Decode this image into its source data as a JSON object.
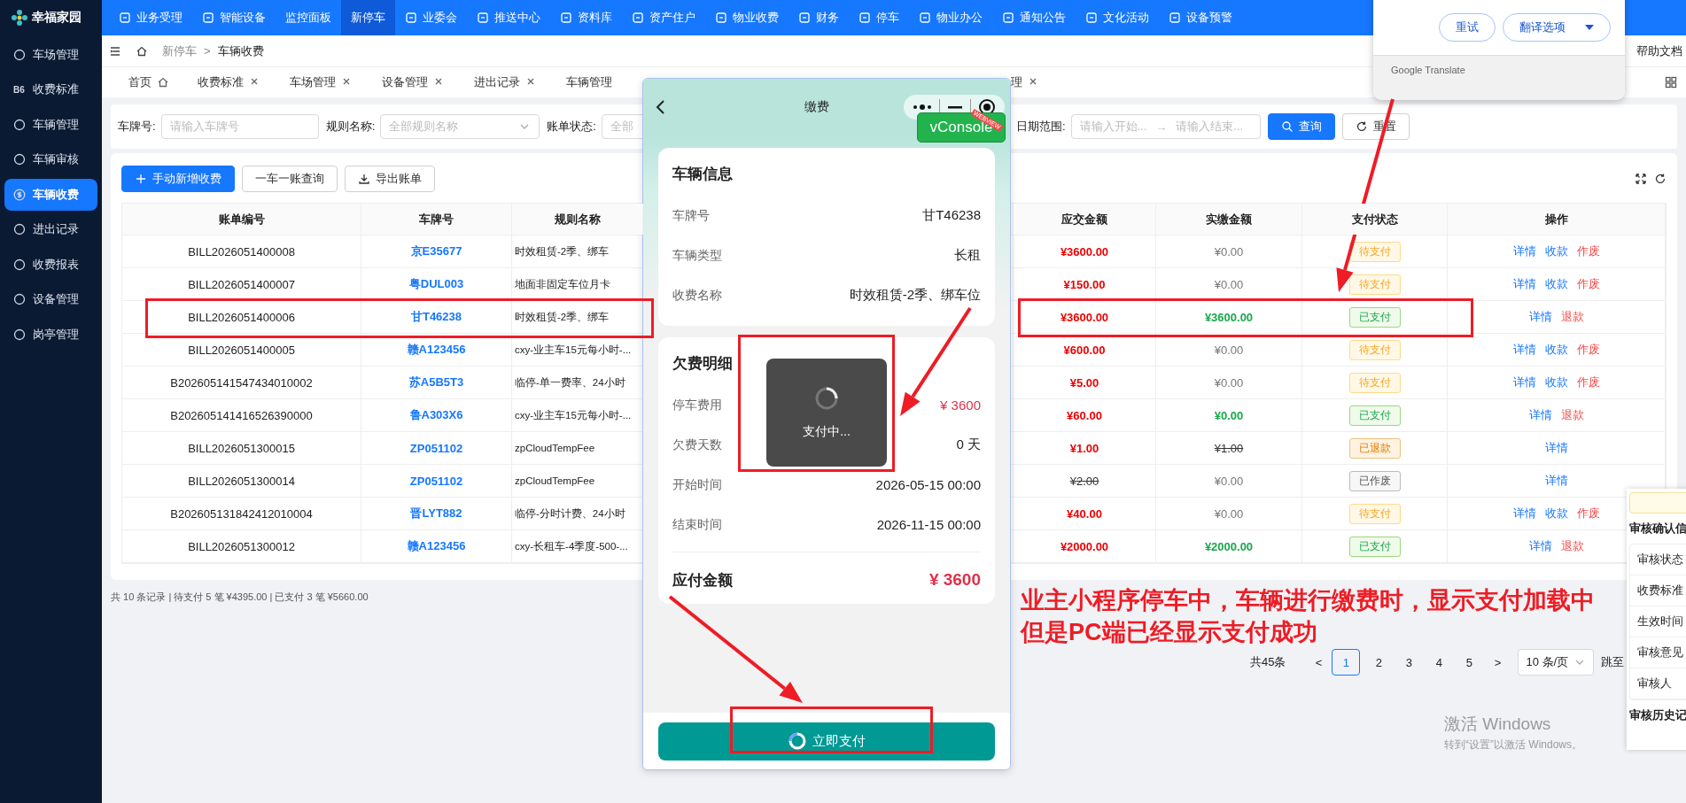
{
  "app": {
    "logo": "幸福家园"
  },
  "top_nav": [
    {
      "label": "业务受理",
      "selected": false,
      "has_icon": true
    },
    {
      "label": "智能设备",
      "selected": false,
      "has_icon": true
    },
    {
      "label": "监控面板",
      "selected": false,
      "has_icon": false
    },
    {
      "label": "新停车",
      "selected": true,
      "has_icon": false
    },
    {
      "label": "业委会",
      "selected": false,
      "has_icon": true
    },
    {
      "label": "推送中心",
      "selected": false,
      "has_icon": true
    },
    {
      "label": "资料库",
      "selected": false,
      "has_icon": true
    },
    {
      "label": "资产住户",
      "selected": false,
      "has_icon": true
    },
    {
      "label": "物业收费",
      "selected": false,
      "has_icon": true
    },
    {
      "label": "财务",
      "selected": false,
      "has_icon": true
    },
    {
      "label": "停车",
      "selected": false,
      "has_icon": true
    },
    {
      "label": "物业办公",
      "selected": false,
      "has_icon": true
    },
    {
      "label": "通知公告",
      "selected": false,
      "has_icon": true
    },
    {
      "label": "文化活动",
      "selected": false,
      "has_icon": true
    },
    {
      "label": "设备预警",
      "selected": false,
      "has_icon": true
    }
  ],
  "sidebar": {
    "items": [
      {
        "label": "车场管理",
        "selected": false
      },
      {
        "label": "收费标准",
        "selected": false,
        "badge": "B6"
      },
      {
        "label": "车辆管理",
        "selected": false
      },
      {
        "label": "车辆审核",
        "selected": false
      },
      {
        "label": "车辆收费",
        "selected": true
      },
      {
        "label": "进出记录",
        "selected": false
      },
      {
        "label": "收费报表",
        "selected": false
      },
      {
        "label": "设备管理",
        "selected": false
      },
      {
        "label": "岗亭管理",
        "selected": false
      }
    ]
  },
  "breadcrumb": {
    "items": [
      "新停车",
      "车辆收费"
    ],
    "separator": ">"
  },
  "help_link": "帮助文档",
  "tab_bar": {
    "tabs": [
      {
        "label": "首页",
        "selected": false,
        "closable": false,
        "home": true
      },
      {
        "label": "收费标准",
        "selected": false,
        "closable": true
      },
      {
        "label": "车场管理",
        "selected": false,
        "closable": true
      },
      {
        "label": "设备管理",
        "selected": false,
        "closable": true
      },
      {
        "label": "进出记录",
        "selected": false,
        "closable": true
      },
      {
        "label": "车辆管理",
        "selected": false,
        "closable": false
      }
    ],
    "more_tabs": [
      {
        "label": "理",
        "selected": false,
        "closable": true
      }
    ]
  },
  "filter_bar": {
    "fields": [
      {
        "label": "车牌号:",
        "placeholder": "请输入车牌号",
        "kind": "text"
      },
      {
        "label": "规则名称:",
        "placeholder": "全部规则名称",
        "kind": "select"
      },
      {
        "label": "账单状态:",
        "placeholder": "全部",
        "kind": "clipped"
      }
    ],
    "date_range": {
      "label": "日期范围:",
      "start_placeholder": "请输入开始...",
      "separator": "→",
      "end_placeholder": "请输入结束..."
    },
    "buttons": [
      {
        "label": "查询",
        "kind": "primary"
      },
      {
        "label": "重置",
        "kind": "default"
      }
    ]
  },
  "toolbar": {
    "buttons": [
      {
        "label": "手动新增收费",
        "kind": "primary"
      },
      {
        "label": "一车一账查询",
        "kind": "default"
      },
      {
        "label": "导出账单",
        "kind": "export"
      }
    ]
  },
  "table": {
    "columns": [
      "账单编号",
      "车牌号",
      "规则名称",
      "应交金额",
      "实缴金额",
      "支付状态",
      "操作"
    ],
    "rows": [
      {
        "bill": "BILL2026051400008",
        "plate": "京E35677",
        "rule": "时效租赁-2季、绑车",
        "due": {
          "text": "¥3600.00",
          "struck": false
        },
        "paid": {
          "text": "¥0.00",
          "struck": false,
          "kind": "muted"
        },
        "status": {
          "label": "待支付",
          "kind": "pending"
        },
        "actions": [
          {
            "label": "详情",
            "kind": "link"
          },
          {
            "label": "收款",
            "kind": "link"
          },
          {
            "label": "作废",
            "kind": "danger"
          }
        ]
      },
      {
        "bill": "BILL2026051400007",
        "plate": "粤DUL003",
        "rule": "地面非固定车位月卡",
        "due": {
          "text": "¥150.00",
          "struck": false
        },
        "paid": {
          "text": "¥0.00",
          "struck": false,
          "kind": "muted"
        },
        "status": {
          "label": "待支付",
          "kind": "pending"
        },
        "actions": [
          {
            "label": "详情",
            "kind": "link"
          },
          {
            "label": "收款",
            "kind": "link"
          },
          {
            "label": "作废",
            "kind": "danger"
          }
        ]
      },
      {
        "bill": "BILL2026051400006",
        "plate": "甘T46238",
        "rule": "时效租赁-2季、绑车",
        "due": {
          "text": "¥3600.00",
          "struck": false
        },
        "paid": {
          "text": "¥3600.00",
          "struck": false,
          "kind": "success"
        },
        "status": {
          "label": "已支付",
          "kind": "paid"
        },
        "actions": [
          {
            "label": "详情",
            "kind": "link"
          },
          {
            "label": "退款",
            "kind": "danger"
          }
        ]
      },
      {
        "bill": "BILL2026051400005",
        "plate": "赣A123456",
        "rule": "cxy-业主车15元每小时-...",
        "due": {
          "text": "¥600.00",
          "struck": false
        },
        "paid": {
          "text": "¥0.00",
          "struck": false,
          "kind": "muted"
        },
        "status": {
          "label": "待支付",
          "kind": "pending"
        },
        "actions": [
          {
            "label": "详情",
            "kind": "link"
          },
          {
            "label": "收款",
            "kind": "link"
          },
          {
            "label": "作废",
            "kind": "danger"
          }
        ]
      },
      {
        "bill": "B202605141547434010002",
        "plate": "苏A5B5T3",
        "rule": "临停-单一费率、24小时",
        "due": {
          "text": "¥5.00",
          "struck": false
        },
        "paid": {
          "text": "¥0.00",
          "struck": false,
          "kind": "muted"
        },
        "status": {
          "label": "待支付",
          "kind": "pending"
        },
        "actions": [
          {
            "label": "详情",
            "kind": "link"
          },
          {
            "label": "收款",
            "kind": "link"
          },
          {
            "label": "作废",
            "kind": "danger"
          }
        ]
      },
      {
        "bill": "B202605141416526390000",
        "plate": "鲁A303X6",
        "rule": "cxy-业主车15元每小时-...",
        "due": {
          "text": "¥60.00",
          "struck": false
        },
        "paid": {
          "text": "¥0.00",
          "struck": false,
          "kind": "success"
        },
        "status": {
          "label": "已支付",
          "kind": "paid"
        },
        "actions": [
          {
            "label": "详情",
            "kind": "link"
          },
          {
            "label": "退款",
            "kind": "danger"
          }
        ]
      },
      {
        "bill": "BILL2026051300015",
        "plate": "ZP051102",
        "rule": "zpCloudTempFee",
        "due": {
          "text": "¥1.00",
          "struck": false
        },
        "paid": {
          "text": "¥1.00",
          "struck": true,
          "kind": "normal"
        },
        "status": {
          "label": "已退款",
          "kind": "refunded"
        },
        "actions": [
          {
            "label": "详情",
            "kind": "link"
          }
        ]
      },
      {
        "bill": "BILL2026051300014",
        "plate": "ZP051102",
        "rule": "zpCloudTempFee",
        "due": {
          "text": "¥2.00",
          "struck": true
        },
        "paid": {
          "text": "¥0.00",
          "struck": false,
          "kind": "muted"
        },
        "status": {
          "label": "已作废",
          "kind": "void"
        },
        "actions": [
          {
            "label": "详情",
            "kind": "link"
          }
        ]
      },
      {
        "bill": "B202605131842412010004",
        "plate": "晋LYT882",
        "rule": "临停-分时计费、24小时",
        "due": {
          "text": "¥40.00",
          "struck": false
        },
        "paid": {
          "text": "¥0.00",
          "struck": false,
          "kind": "muted"
        },
        "status": {
          "label": "待支付",
          "kind": "pending"
        },
        "actions": [
          {
            "label": "详情",
            "kind": "link"
          },
          {
            "label": "收款",
            "kind": "link"
          },
          {
            "label": "作废",
            "kind": "danger"
          }
        ]
      },
      {
        "bill": "BILL2026051300012",
        "plate": "赣A123456",
        "rule": "cxy-长租车-4季度-500-...",
        "due": {
          "text": "¥2000.00",
          "struck": false
        },
        "paid": {
          "text": "¥2000.00",
          "struck": false,
          "kind": "success"
        },
        "status": {
          "label": "已支付",
          "kind": "paid"
        },
        "actions": [
          {
            "label": "详情",
            "kind": "link"
          },
          {
            "label": "退款",
            "kind": "danger"
          }
        ]
      }
    ]
  },
  "summary": "共 10 条记录 | 待支付 5 笔 ¥4395.00 | 已支付 3 笔 ¥5660.00",
  "pagination": {
    "total": "共45条",
    "prev": "<",
    "pages": [
      {
        "label": "1",
        "selected": true
      },
      {
        "label": "2",
        "selected": false
      },
      {
        "label": "3",
        "selected": false
      },
      {
        "label": "4",
        "selected": false
      },
      {
        "label": "5",
        "selected": false
      }
    ],
    "next": ">",
    "page_size": "10 条/页",
    "jump": "跳至"
  },
  "phone": {
    "title": "缴费",
    "vconsole": {
      "label": "vConsole",
      "ribbon": "WEBVIEW"
    },
    "vehicle_card": {
      "title": "车辆信息",
      "rows": [
        {
          "label": "车牌号",
          "value": "甘T46238"
        },
        {
          "label": "车辆类型",
          "value": "长租"
        },
        {
          "label": "收费名称",
          "value": "时效租赁-2季、绑车位"
        }
      ]
    },
    "arrears_card": {
      "title": "欠费明细",
      "rows": [
        {
          "label": "停车费用",
          "value": "¥ 3600",
          "kind": "danger"
        },
        {
          "label": "欠费天数",
          "value": "0 天",
          "kind": "normal"
        },
        {
          "label": "开始时间",
          "value": "2026-05-15 00:00",
          "kind": "normal"
        },
        {
          "label": "结束时间",
          "value": "2026-11-15 00:00",
          "kind": "normal"
        }
      ],
      "total": {
        "label": "应付金额",
        "value": "¥ 3600"
      }
    },
    "toast": {
      "text": "支付中..."
    },
    "pay_button": {
      "label": "立即支付",
      "loading": true
    }
  },
  "translate_popup": {
    "buttons": [
      {
        "label": "重试",
        "kind": "plain"
      },
      {
        "label": "翻译选项",
        "kind": "dropdown"
      }
    ],
    "footer": "Google Translate"
  },
  "review_panel": {
    "title": "审核确认信",
    "rows": [
      "审核状态",
      "收费标准",
      "生效时间",
      "审核意见",
      "审核人"
    ],
    "history_title": "审核历史记"
  },
  "annotation": {
    "lines": [
      "业主小程序停车中，车辆进行缴费时，显示支付加载中",
      "但是PC端已经显示支付成功"
    ]
  },
  "os_notice": {
    "title": "激活 Windows",
    "text": "转到“设置”以激活 Windows。"
  }
}
